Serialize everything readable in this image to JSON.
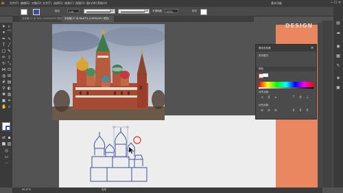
{
  "app": {
    "brand": "Ai"
  },
  "menubar": {
    "items": [
      "文件(F)",
      "编辑(E)",
      "对象(O)",
      "文字(T)",
      "选择(S)",
      "效果(C)",
      "视图(V)",
      "窗口(W)",
      "帮助(H)"
    ],
    "right_label": "基本功能"
  },
  "controlbar": {
    "stroke_label": "描边",
    "stroke_value": "1 pt",
    "profile_label": "等比",
    "brush_label": "基本",
    "opacity_label": "不透明度",
    "opacity_value": "100%",
    "style_label": "样式"
  },
  "tabs": [
    {
      "label": "未标题-1* @ 50% (CMYK/GPU 预览)",
      "active": false
    },
    {
      "label": "未标题-2* @ 66.67% (CMYK/GPU 预览)",
      "active": true
    }
  ],
  "orange_panel": {
    "title": "DESIGN"
  },
  "panel": {
    "title": "路径查找器",
    "mode_label": "形状模式：",
    "color_section": "颜色",
    "align_label": "对齐对象：",
    "distribute_label": "分布对象："
  },
  "statusbar": {
    "zoom": "66.67%",
    "tool": "选择"
  },
  "colors": {
    "accent_orange": "#e8875f",
    "outline_blue": "#3a4f9c",
    "highlight_red": "#e24a4a"
  }
}
